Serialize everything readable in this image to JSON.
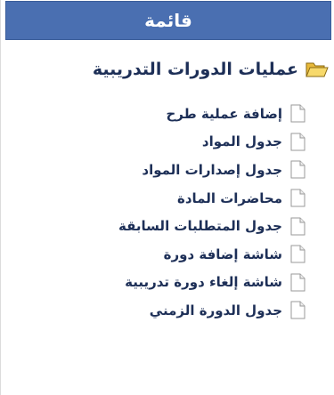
{
  "menu": {
    "title": "قائمة",
    "header_color": "#4a6fb1",
    "text_color": "#1d2f57",
    "folder": {
      "label": "عمليات الدورات التدريبية",
      "icon": "folder-open-icon",
      "icon_color": "#f2c744"
    },
    "items": [
      {
        "label": "إضافة عملية طرح",
        "icon": "document-icon"
      },
      {
        "label": "جدول المواد",
        "icon": "document-icon"
      },
      {
        "label": "جدول إصدارات المواد",
        "icon": "document-icon"
      },
      {
        "label": "محاضرات المادة",
        "icon": "document-icon"
      },
      {
        "label": "جدول المتطلبات السابقة",
        "icon": "document-icon"
      },
      {
        "label": "شاشة إضافة دورة",
        "icon": "document-icon"
      },
      {
        "label": "شاشة إلغاء دورة تدريبية",
        "icon": "document-icon"
      },
      {
        "label": "جدول الدورة الزمني",
        "icon": "document-icon"
      }
    ]
  }
}
